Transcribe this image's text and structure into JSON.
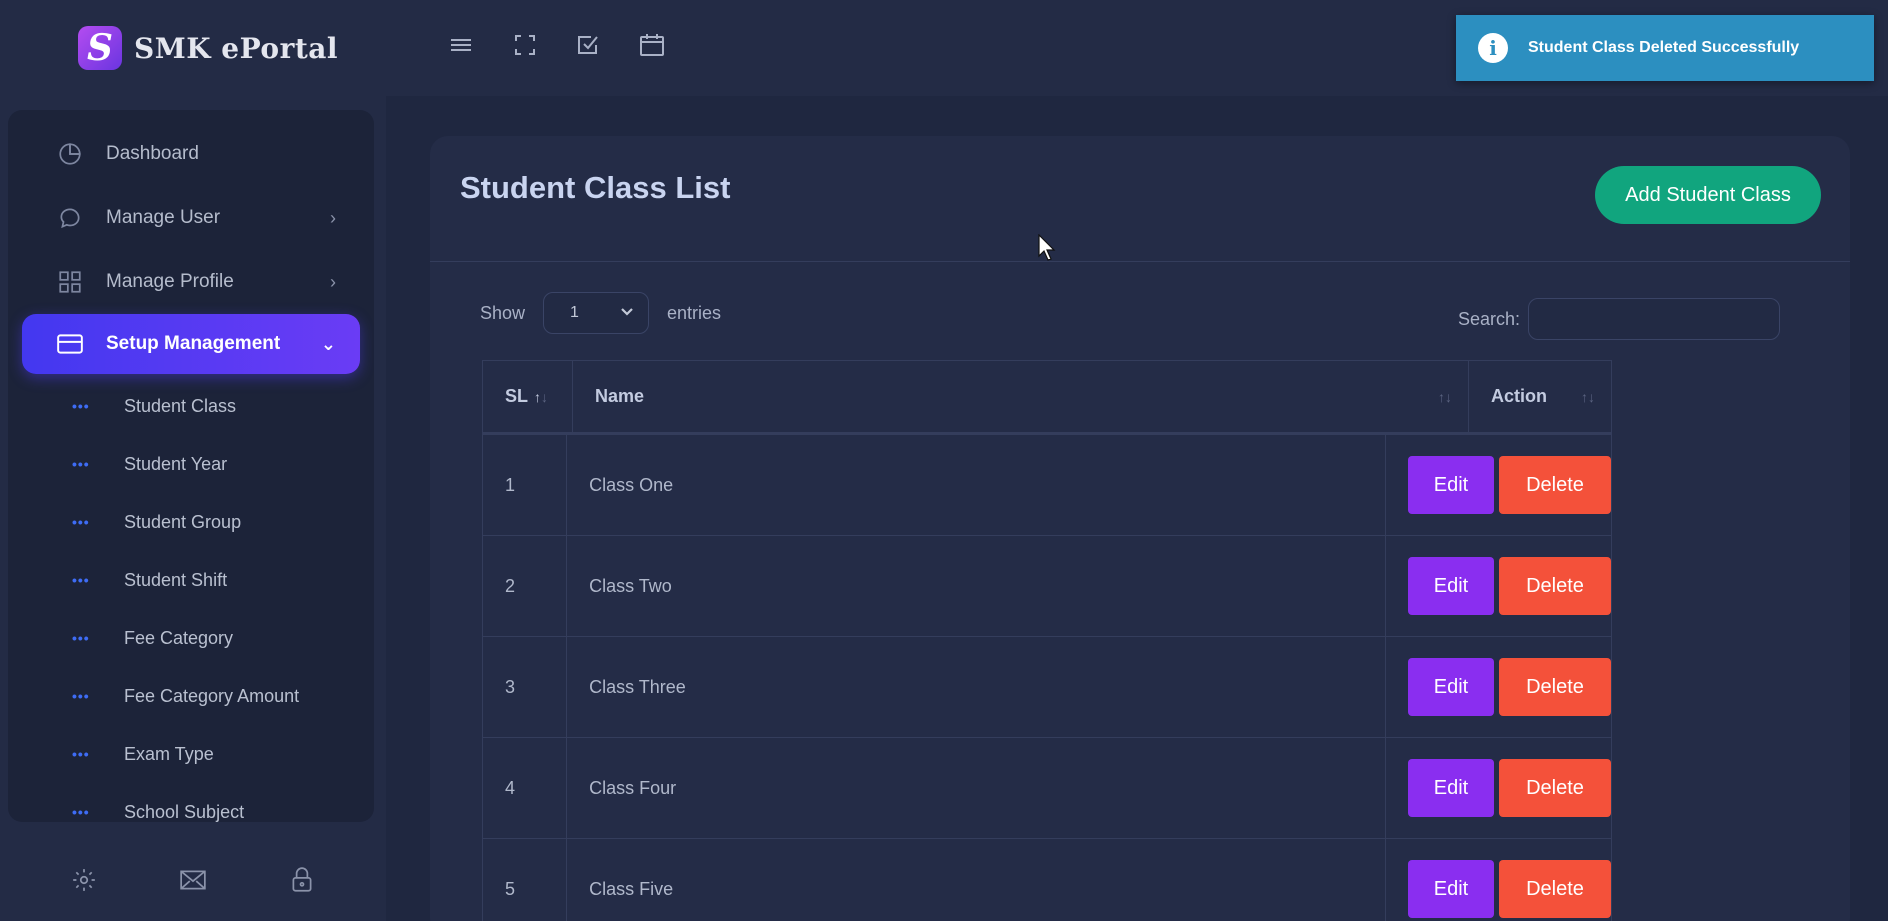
{
  "brand": {
    "logo_letter": "S",
    "name": "SMK ePortal"
  },
  "sidebar": {
    "items": [
      {
        "label": "Dashboard",
        "icon": "pie-chart-icon"
      },
      {
        "label": "Manage User",
        "icon": "chat-bubble-icon"
      },
      {
        "label": "Manage Profile",
        "icon": "grid-icon"
      },
      {
        "label": "Setup Management",
        "icon": "card-icon"
      }
    ],
    "sub_items": [
      {
        "label": "Student Class"
      },
      {
        "label": "Student Year"
      },
      {
        "label": "Student Group"
      },
      {
        "label": "Student Shift"
      },
      {
        "label": "Fee Category"
      },
      {
        "label": "Fee Category Amount"
      },
      {
        "label": "Exam Type"
      },
      {
        "label": "School Subject"
      }
    ],
    "footer_icons": [
      "settings-icon",
      "mail-icon",
      "lock-icon"
    ]
  },
  "topbar": {
    "icons": [
      "menu-icon",
      "fullscreen-icon",
      "checkbox-icon",
      "calendar-icon"
    ]
  },
  "toast": {
    "message": "Student Class Deleted Successfully",
    "icon": "info-icon",
    "color": "#2c8fc0"
  },
  "page": {
    "title": "Student Class List",
    "add_button": "Add Student Class",
    "show_label": "Show",
    "entries_value": "1",
    "entries_label": "entries",
    "search_label": "Search:",
    "search_value": ""
  },
  "table": {
    "headers": {
      "sl": "SL",
      "name": "Name",
      "action": "Action"
    },
    "rows": [
      {
        "sl": "1",
        "name": "Class One"
      },
      {
        "sl": "2",
        "name": "Class Two"
      },
      {
        "sl": "3",
        "name": "Class Three"
      },
      {
        "sl": "4",
        "name": "Class Four"
      },
      {
        "sl": "5",
        "name": "Class Five"
      }
    ],
    "edit_label": "Edit",
    "delete_label": "Delete"
  },
  "colors": {
    "active_menu": "#4f3af2",
    "add_button": "#11a57e",
    "edit_button": "#8a2ef0",
    "delete_button": "#f4513a"
  }
}
